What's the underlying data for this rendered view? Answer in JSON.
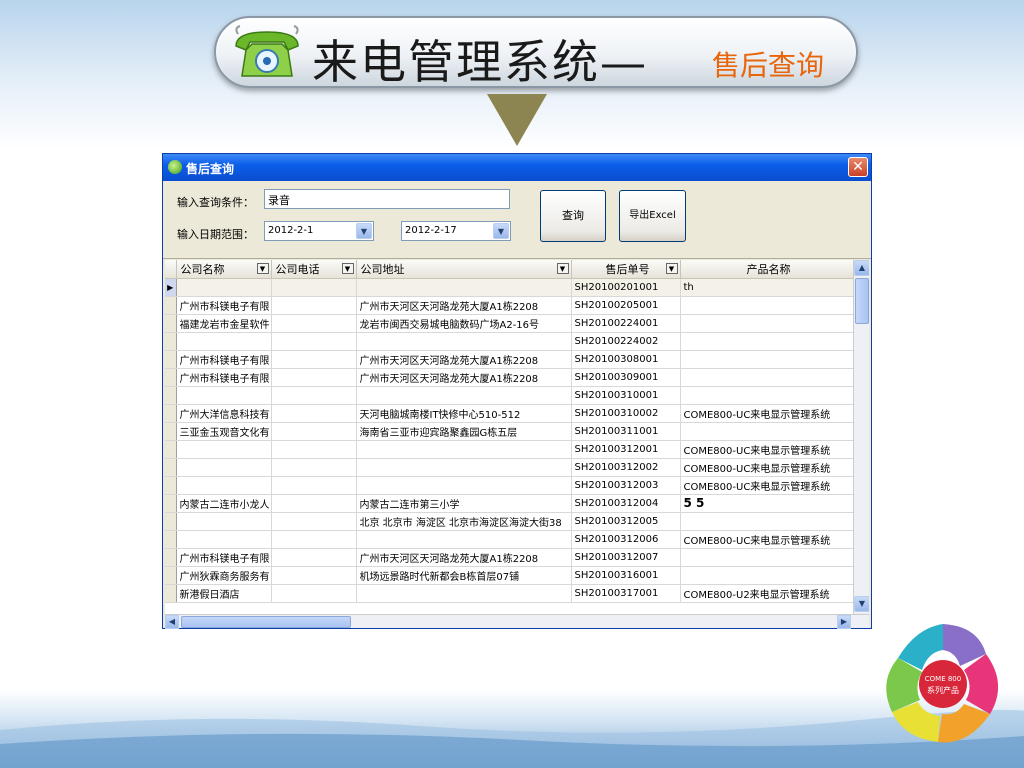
{
  "banner": {
    "title": "来电管理系统—",
    "subtitle": "售后查询"
  },
  "window": {
    "title": "售后查询",
    "close_glyph": "✕"
  },
  "form": {
    "query_label": "输入查询条件：",
    "query_value": "录音",
    "date_label": "输入日期范围：",
    "date_from": "2012-2-1",
    "date_to": "2012-2-17",
    "search_button": "查询",
    "export_button": "导出Excel"
  },
  "grid": {
    "columns": [
      "公司名称",
      "公司电话",
      "公司地址",
      "售后单号",
      "产品名称"
    ],
    "rows": [
      [
        "",
        "",
        "",
        "SH20100201001",
        "th"
      ],
      [
        "广州市科镁电子有限",
        "",
        "广州市天河区天河路龙苑大厦A1栋2208",
        "SH20100205001",
        ""
      ],
      [
        "福建龙岩市金星软件",
        "",
        "龙岩市闽西交易城电脑数码广场A2-16号",
        "SH20100224001",
        ""
      ],
      [
        "",
        "",
        "",
        "SH20100224002",
        ""
      ],
      [
        "广州市科镁电子有限",
        "",
        "广州市天河区天河路龙苑大厦A1栋2208",
        "SH20100308001",
        ""
      ],
      [
        "广州市科镁电子有限",
        "",
        "广州市天河区天河路龙苑大厦A1栋2208",
        "SH20100309001",
        ""
      ],
      [
        "",
        "",
        "",
        "SH20100310001",
        ""
      ],
      [
        "广州大洋信息科技有",
        "",
        "天河电脑城南楼IT快修中心510-512",
        "SH20100310002",
        "COME800-UC来电显示管理系统"
      ],
      [
        "三亚金玉观音文化有",
        "",
        "海南省三亚市迎宾路聚鑫园G栋五层",
        "SH20100311001",
        ""
      ],
      [
        "",
        "",
        "",
        "SH20100312001",
        "COME800-UC来电显示管理系统"
      ],
      [
        "",
        "",
        "",
        "SH20100312002",
        "COME800-UC来电显示管理系统"
      ],
      [
        "",
        "",
        "",
        "SH20100312003",
        "COME800-UC来电显示管理系统"
      ],
      [
        "内蒙古二连市小龙人",
        "",
        "内蒙古二连市第三小学",
        "SH20100312004",
        "5 5"
      ],
      [
        "",
        "",
        "北京 北京市 海淀区 北京市海淀区海淀大街38",
        "SH20100312005",
        ""
      ],
      [
        "",
        "",
        "",
        "SH20100312006",
        "COME800-UC来电显示管理系统"
      ],
      [
        "广州市科镁电子有限",
        "",
        "广州市天河区天河路龙苑大厦A1栋2208",
        "SH20100312007",
        ""
      ],
      [
        "广州狄霖商务服务有",
        "",
        "机场远景路时代新都会B栋首层07铺",
        "SH20100316001",
        ""
      ],
      [
        "新港假日酒店",
        "",
        "",
        "SH20100317001",
        "COME800-U2来电显示管理系统"
      ]
    ]
  },
  "logo": {
    "text_line1": "COME 800",
    "text_line2": "系列产品"
  },
  "icons": {
    "dropdown": "chevron-down-icon",
    "scroll_up": "chevron-up-icon",
    "scroll_down": "chevron-down-icon",
    "scroll_left": "chevron-left-icon",
    "scroll_right": "chevron-right-icon",
    "row_pointer": "row-pointer-icon"
  },
  "colors": {
    "title_orange": "#e8650c",
    "titlebar_blue": "#0c5ee8",
    "arrow_olive": "#8c8552"
  }
}
